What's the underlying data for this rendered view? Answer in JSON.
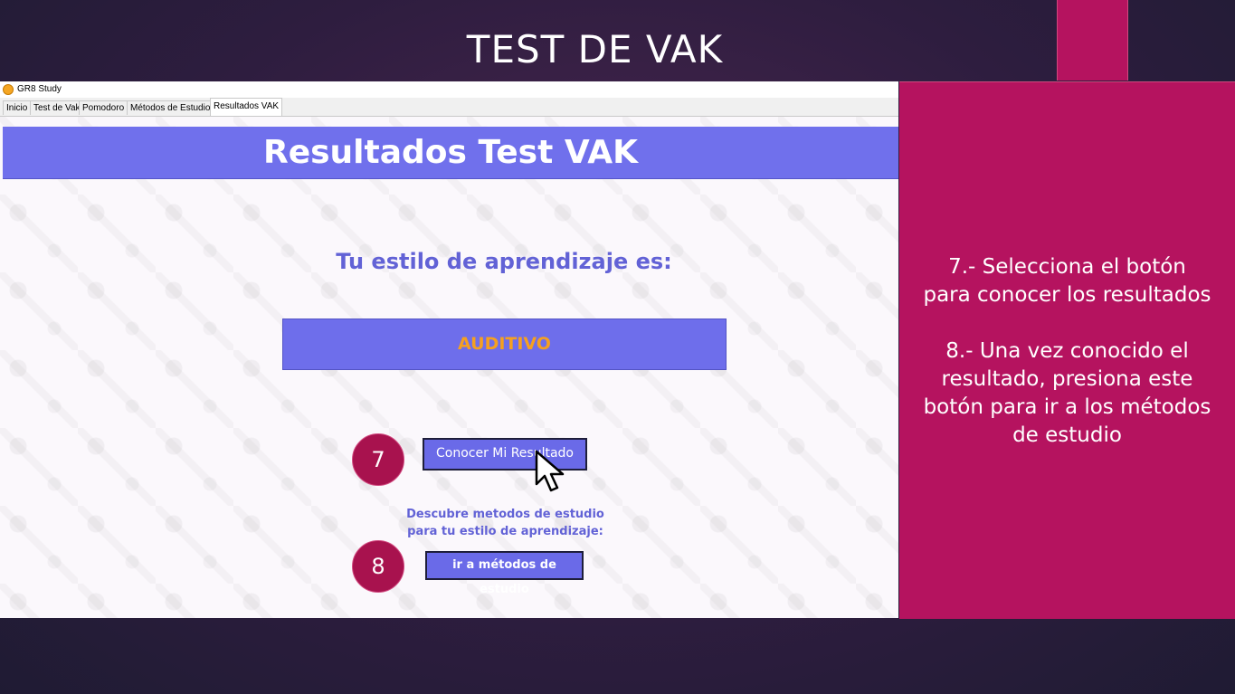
{
  "slide": {
    "title": "TEST DE VAK",
    "colors": {
      "accent": "#b5135f",
      "background": "#2e1d3f"
    }
  },
  "app": {
    "window_title": "GR8 Study",
    "tabs": [
      {
        "label": "Inicio",
        "active": false
      },
      {
        "label": "Test de Vak",
        "active": false
      },
      {
        "label": "Pomodoro",
        "active": false
      },
      {
        "label": "Métodos de Estudio",
        "active": false
      },
      {
        "label": "Resultados VAK",
        "active": true
      }
    ],
    "header_title": "Resultados Test VAK",
    "subtitle": "Tu estilo de aprendizaje es:",
    "result_value": "AUDITIVO",
    "result_button": "Conocer Mi Resultado",
    "discover_line1": "Descubre metodos de estudio",
    "discover_line2": "para tu estilo de aprendizaje:",
    "methods_button": "ir a métodos de estudio",
    "colors": {
      "header": "#7070ec",
      "result_text": "#f5a020",
      "button": "#6a6ae8"
    }
  },
  "steps": [
    {
      "number": "7"
    },
    {
      "number": "8"
    }
  ],
  "instructions": {
    "step7_line1": "7.- Selecciona el botón",
    "step7_line2": "para conocer los resultados",
    "step8_line1": "8.- Una vez conocido el",
    "step8_line2": "resultado, presiona este",
    "step8_line3": "botón para ir a los métodos",
    "step8_line4": "de estudio"
  },
  "icons": {
    "app_icon": "gr8-app-icon",
    "cursor": "arrow-cursor-icon"
  }
}
